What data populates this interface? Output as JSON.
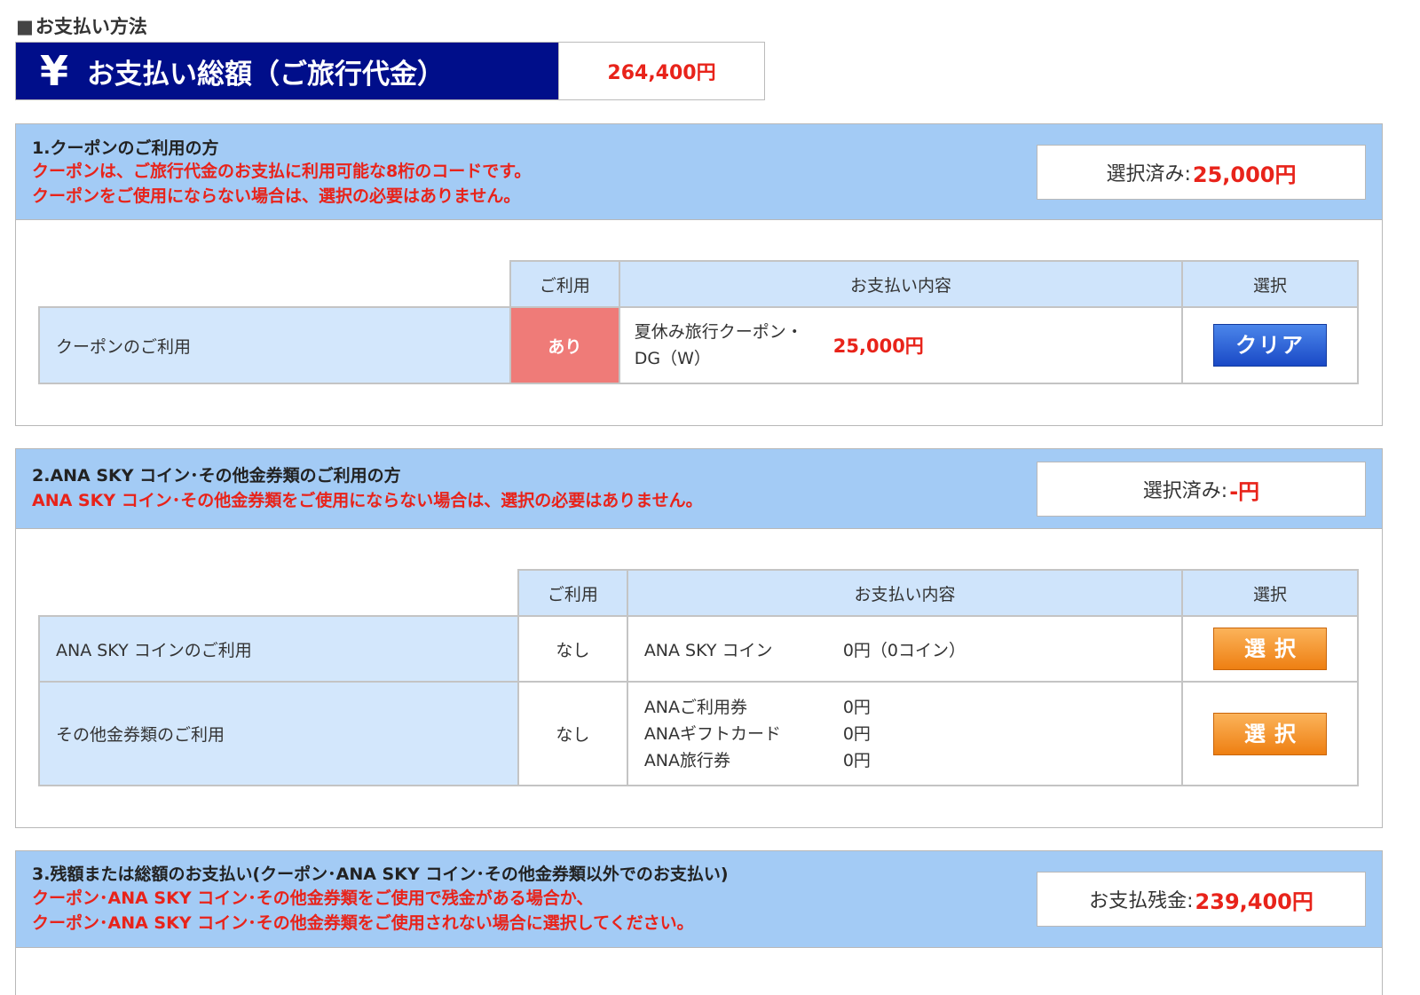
{
  "page": {
    "heading_marker": "■",
    "heading": "お支払い方法",
    "yen_icon": "¥",
    "total_label": "お支払い総額（ご旅行代金）",
    "total_value": "264,400円"
  },
  "section1": {
    "title": "1.クーポンのご利用の方",
    "note1": "クーポンは、ご旅行代金のお支払に利用可能な8桁のコードです。",
    "note2": "クーポンをご使用にならない場合は、選択の必要はありません。",
    "selected_label": "選択済み:",
    "selected_value": "25,000円",
    "headers": {
      "use": "ご利用",
      "detail": "お支払い内容",
      "select": "選択"
    },
    "row": {
      "label": "クーポンのご利用",
      "use": "あり",
      "detail_name_line1": "夏休み旅行クーポン・",
      "detail_name_line2": "DG（W）",
      "detail_amount": "25,000円",
      "button": "クリア"
    }
  },
  "section2": {
    "title": "2.ANA SKY コイン･その他金券類のご利用の方",
    "note1": "ANA SKY コイン･その他金券類をご使用にならない場合は、選択の必要はありません。",
    "selected_label": "選択済み:",
    "selected_value": "-円",
    "headers": {
      "use": "ご利用",
      "detail": "お支払い内容",
      "select": "選択"
    },
    "rows": [
      {
        "label": "ANA SKY コインのご利用",
        "use": "なし",
        "items": [
          {
            "name": "ANA SKY コイン",
            "value": "0円（0コイン）"
          }
        ],
        "button": "選択"
      },
      {
        "label": "その他金券類のご利用",
        "use": "なし",
        "items": [
          {
            "name": "ANAご利用券",
            "value": "0円"
          },
          {
            "name": "ANAギフトカード",
            "value": "0円"
          },
          {
            "name": "ANA旅行券",
            "value": "0円"
          }
        ],
        "button": "選択"
      }
    ]
  },
  "section3": {
    "title": "3.残額または総額のお支払い(クーポン･ANA SKY コイン･その他金券類以外でのお支払い)",
    "note1": "クーポン･ANA SKY コイン･その他金券類をご使用で残金がある場合か、",
    "note2": "クーポン･ANA SKY コイン･その他金券類をご使用されない場合に選択してください。",
    "balance_label": "お支払残金:",
    "balance_value": "239,400円"
  },
  "colors": {
    "header_navy": "#000e8a",
    "section_header_blue": "#a3cbf5",
    "label_cell_blue": "#d3e7fc",
    "accent_red": "#e8231a",
    "use_yes_pink": "#ef7b78",
    "clear_button_blue": "#1a49c6",
    "select_button_orange": "#ee7f12"
  }
}
